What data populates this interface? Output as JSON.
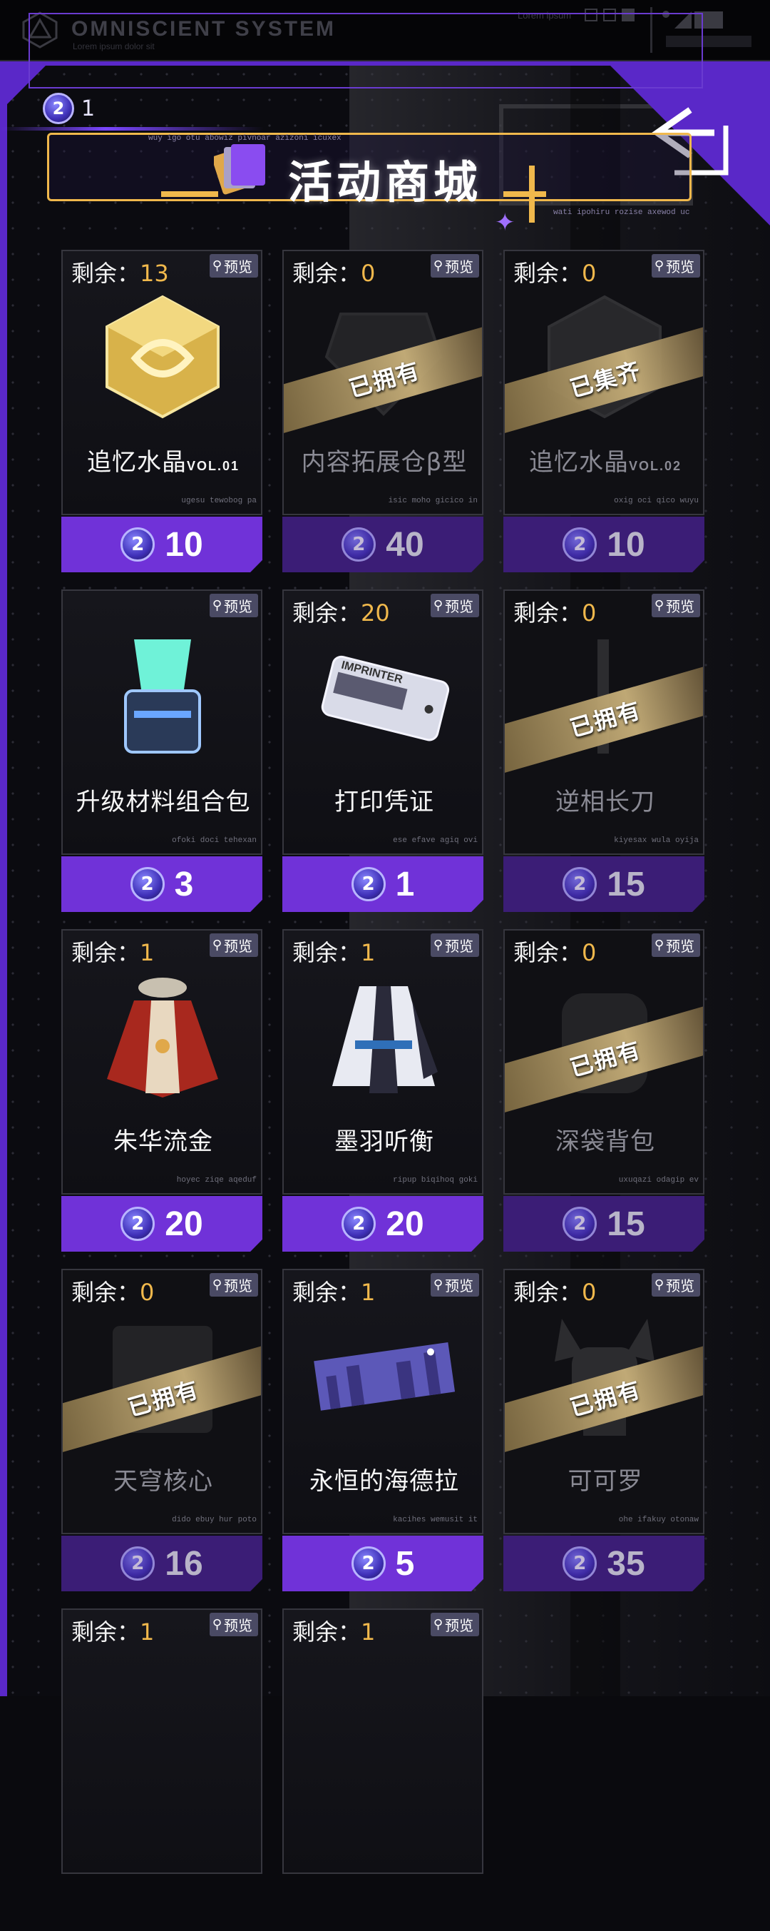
{
  "system": {
    "title": "OMNISCIENT  SYSTEM",
    "subtitle": "Lorem ipsum dolor sit",
    "right_text": "Lorem ipsum"
  },
  "currency": {
    "count": "1",
    "coin_glyph": "2"
  },
  "banner": {
    "title": "活动商城",
    "tiny_top": "wuy igo otu abowiz pivnoar azizoni icuxex",
    "tiny_bottom": "wati ipohiru rozise axewod uc"
  },
  "remaining_label": "剩余：",
  "preview_label": "预览",
  "items": [
    {
      "name": "追忆水晶",
      "suffix": "VOL.01",
      "remaining": "13",
      "price": "10",
      "owned": false,
      "badge": "",
      "tiny": "ugesu tewobog pa",
      "icon": "gold-crystal-icon"
    },
    {
      "name": "内容拓展仓β型",
      "suffix": "",
      "remaining": "0",
      "price": "40",
      "owned": true,
      "badge": "已拥有",
      "tiny": "isic moho gicico in",
      "icon": "storage-module-icon"
    },
    {
      "name": "追忆水晶",
      "suffix": "VOL.02",
      "remaining": "0",
      "price": "10",
      "owned": true,
      "badge": "已集齐",
      "tiny": "oxig oci qico wuyu",
      "icon": "crystal-icon"
    },
    {
      "name": "升级材料组合包",
      "suffix": "",
      "remaining": "",
      "price": "3",
      "owned": false,
      "badge": "",
      "tiny": "ofoki doci tehexan",
      "icon": "material-box-icon"
    },
    {
      "name": "打印凭证",
      "suffix": "",
      "remaining": "20",
      "price": "1",
      "owned": false,
      "badge": "",
      "tiny": "ese efave agiq ovi",
      "icon": "print-ticket-icon",
      "ticket_text": "IMPRINTER"
    },
    {
      "name": "逆相长刀",
      "suffix": "",
      "remaining": "0",
      "price": "15",
      "owned": true,
      "badge": "已拥有",
      "tiny": "kiyesax wula oyija",
      "icon": "blade-icon"
    },
    {
      "name": "朱华流金",
      "suffix": "",
      "remaining": "1",
      "price": "20",
      "owned": false,
      "badge": "",
      "tiny": "hoyec ziqe aqeduf",
      "icon": "red-outfit-icon"
    },
    {
      "name": "墨羽听衡",
      "suffix": "",
      "remaining": "1",
      "price": "20",
      "owned": false,
      "badge": "",
      "tiny": "ripup biqihoq goki",
      "icon": "white-outfit-icon"
    },
    {
      "name": "深袋背包",
      "suffix": "",
      "remaining": "0",
      "price": "15",
      "owned": true,
      "badge": "已拥有",
      "tiny": "uxuqazi odagip ev",
      "icon": "backpack-icon"
    },
    {
      "name": "天穹核心",
      "suffix": "",
      "remaining": "0",
      "price": "16",
      "owned": true,
      "badge": "已拥有",
      "tiny": "dido ebuy hur poto",
      "icon": "core-icon"
    },
    {
      "name": "永恒的海德拉",
      "suffix": "",
      "remaining": "1",
      "price": "5",
      "owned": false,
      "badge": "",
      "tiny": "kacihes wemusit it",
      "icon": "city-banner-icon"
    },
    {
      "name": "可可罗",
      "suffix": "",
      "remaining": "0",
      "price": "35",
      "owned": true,
      "badge": "已拥有",
      "tiny": "ohe ifakuy otonaw",
      "icon": "robot-doll-icon"
    },
    {
      "name": "",
      "suffix": "",
      "remaining": "1",
      "price": "",
      "owned": false,
      "badge": "",
      "tiny": "",
      "icon": ""
    },
    {
      "name": "",
      "suffix": "",
      "remaining": "1",
      "price": "",
      "owned": false,
      "badge": "",
      "tiny": "",
      "icon": ""
    }
  ]
}
